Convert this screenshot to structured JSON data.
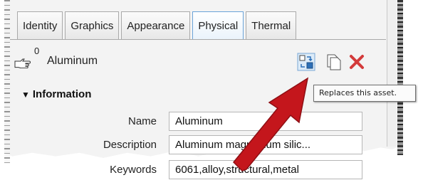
{
  "tabs": [
    {
      "label": "Identity",
      "active": false
    },
    {
      "label": "Graphics",
      "active": false
    },
    {
      "label": "Appearance",
      "active": false
    },
    {
      "label": "Physical",
      "active": true
    },
    {
      "label": "Thermal",
      "active": false
    }
  ],
  "asset": {
    "usage_count": "0",
    "name": "Aluminum",
    "icons": [
      "hand-icon",
      "replace-asset-icon",
      "duplicate-asset-icon",
      "delete-asset-icon"
    ]
  },
  "tooltip": {
    "text": "Replaces this asset."
  },
  "information": {
    "title": "Information",
    "fields": [
      {
        "label": "Name",
        "value": "Aluminum"
      },
      {
        "label": "Description",
        "value": "Aluminum magnesium silic..."
      },
      {
        "label": "Keywords",
        "value": "6061,alloy,structural,metal"
      }
    ]
  },
  "colors": {
    "arrow": "#c4161c",
    "active_tab_border": "#6aa3d8",
    "delete_icon": "#d33a3a"
  }
}
